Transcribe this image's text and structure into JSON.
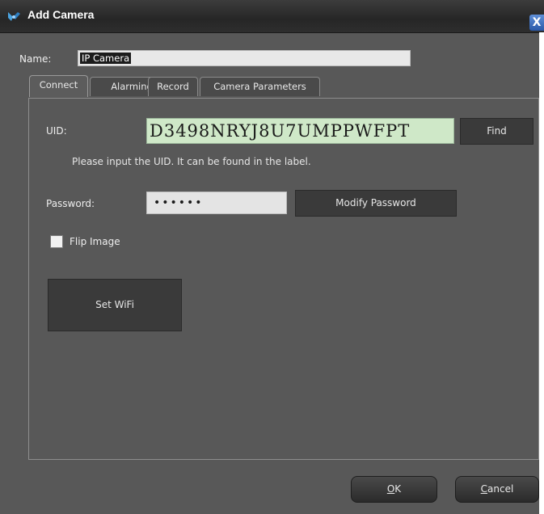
{
  "window": {
    "title": "Add Camera",
    "close_glyph": "X"
  },
  "name": {
    "label": "Name:",
    "value": "IP Camera"
  },
  "tabs": [
    {
      "label": "Connect"
    },
    {
      "label": "Alarming"
    },
    {
      "label": "Record"
    },
    {
      "label": "Camera Parameters"
    }
  ],
  "connect": {
    "uid_label": "UID:",
    "uid_value": "D3498NRYJ8U7UMPPWFPT",
    "find_label": "Find",
    "hint": "Please input the UID. It can be found in the label.",
    "password_label": "Password:",
    "password_value": "••••••",
    "modify_label": "Modify Password",
    "flip_label": "Flip Image",
    "flip_checked": false,
    "wifi_label": "Set WiFi"
  },
  "footer": {
    "ok_mnemonic": "O",
    "ok_rest": "K",
    "cancel_mnemonic": "C",
    "cancel_rest": "ancel"
  },
  "colors": {
    "window_bg": "#585858",
    "uid_bg": "#cfe8c8",
    "button_bg": "#3a3a3a"
  },
  "icons": {
    "app": "camera-icon",
    "close": "close-icon"
  }
}
